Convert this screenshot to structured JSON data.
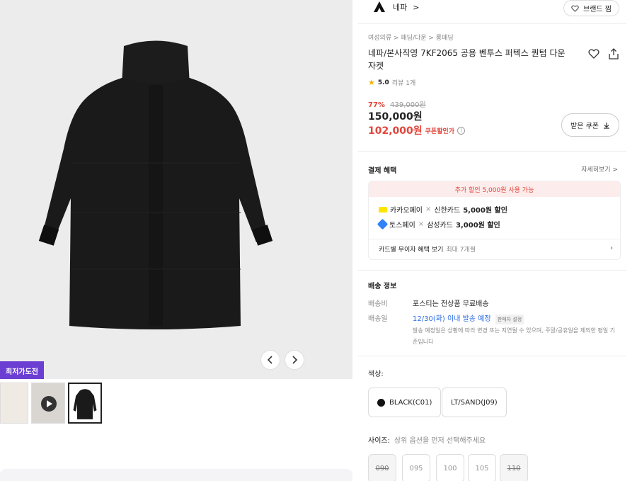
{
  "colors": {
    "accent": "#e1453b",
    "purple_badge": "#6b3fd2",
    "link_blue": "#2b6be6",
    "star": "#f3b400"
  },
  "gallery": {
    "badge": "최저가도전",
    "thumbnails": [
      "thumbnail-1",
      "thumbnail-2-video",
      "thumbnail-3"
    ]
  },
  "brand": {
    "name": "네파",
    "arrow": ">",
    "like_label": "브랜드 찜"
  },
  "product": {
    "breadcrumb": "여성의류 > 패딩/다운 > 롱패딩",
    "title": "네파/본사직영 7KF2065 공용 벤투스 퍼텍스 퀀텀 다운 자켓",
    "rating_score": "5.0",
    "review_count": "리뷰 1개",
    "discount_rate": "77%",
    "original_price": "439,000원",
    "price": "150,000원",
    "coupon_price": "102,000원",
    "coupon_label": "쿠폰할인가",
    "coupon_button": "받은 쿠폰"
  },
  "payment": {
    "title": "결제 혜택",
    "detail_link": "자세히보기 >",
    "extra_discount": "추가 할인 5,000원 사용 가능",
    "benefits": [
      {
        "pay": "카카오페이",
        "sep": "×",
        "card": "신한카드",
        "amount": "5,000원 할인"
      },
      {
        "pay": "토스페이",
        "sep": "×",
        "card": "삼성카드",
        "amount": "3,000원 할인"
      }
    ],
    "installment": "카드별 무이자 혜택 보기",
    "installment_sub": "최대 7개월"
  },
  "shipping": {
    "title": "배송 정보",
    "fee_label": "배송비",
    "fee_value": "포스티는 전상품 무료배송",
    "date_label": "배송일",
    "date_value": "12/30(화) 이내 발송 예정",
    "seller_tag": "판매자 설정",
    "note": "발송 예정일은 상황에 따라 변경 또는 지연될 수 있으며, 주말/공휴일을 제외한 평일 기준입니다"
  },
  "options": {
    "color_label": "색상:",
    "colors": [
      "BLACK(C01)",
      "LT/SAND(J09)"
    ],
    "size_label": "사이즈:",
    "size_hint": "상위 옵션을 먼저 선택해주세요",
    "sizes": [
      {
        "label": "090",
        "soldout": true
      },
      {
        "label": "095",
        "soldout": false
      },
      {
        "label": "100",
        "soldout": false
      },
      {
        "label": "105",
        "soldout": false
      },
      {
        "label": "110",
        "soldout": true
      }
    ]
  }
}
